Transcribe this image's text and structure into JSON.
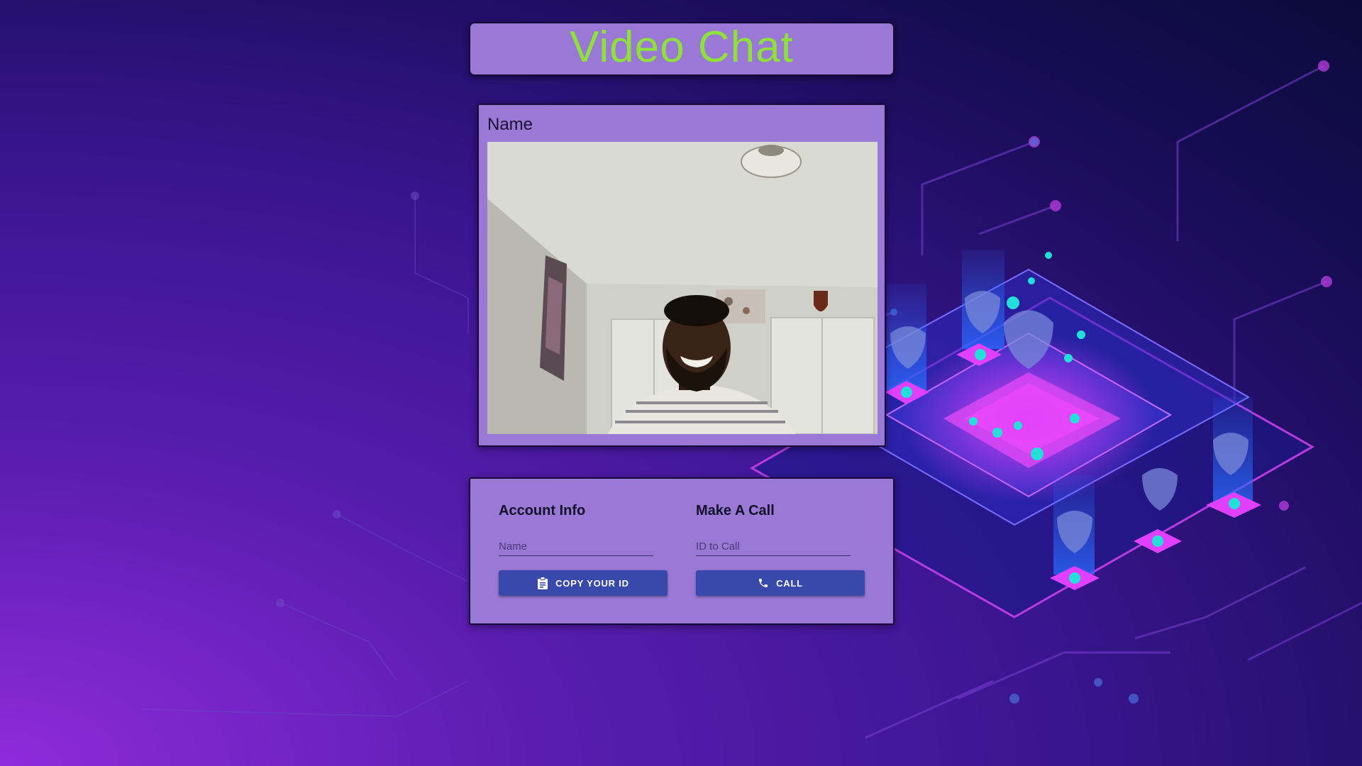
{
  "header": {
    "title": "Video Chat",
    "title_color": "#8ee03a"
  },
  "video": {
    "name_label": "Name",
    "content": "webcam-feed"
  },
  "account": {
    "heading": "Account Info",
    "name_placeholder": "Name",
    "name_value": "",
    "copy_button_label": "COPY YOUR ID",
    "copy_icon": "clipboard-icon"
  },
  "call": {
    "heading": "Make A Call",
    "id_placeholder": "ID to Call",
    "id_value": "",
    "call_button_label": "CALL",
    "call_icon": "phone-icon"
  },
  "colors": {
    "card_bg": "#9a78d6",
    "button_bg": "#3949ab",
    "accent_pink": "#e040fb",
    "accent_cyan": "#22e0d8"
  }
}
